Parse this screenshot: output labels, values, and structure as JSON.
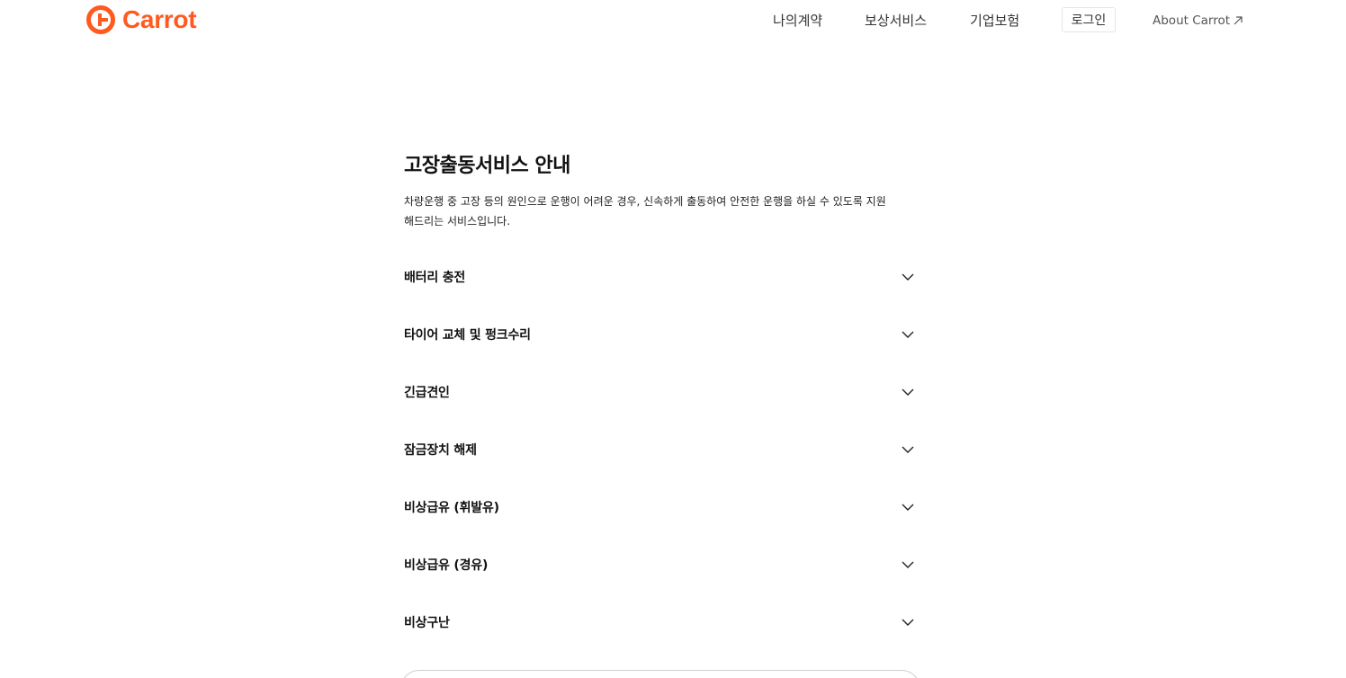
{
  "header": {
    "logo_text": "Carrot",
    "brand_color": "#ff5a1f",
    "nav": {
      "my_contract": "나의계약",
      "claim_service": "보상서비스",
      "corporate": "기업보험",
      "login": "로그인",
      "about": "About Carrot"
    },
    "about_icon": "arrow-up-right-icon"
  },
  "main": {
    "title": "고장출동서비스 안내",
    "description": "차량운행 중 고장 등의 원인으로 운행이 어려운 경우, 신속하게 출동하여 안전한 운행을 하실 수 있도록 지원해드리는 서비스입니다.",
    "accordion": [
      {
        "label": "배터리 충전",
        "icon": "chevron-down-icon"
      },
      {
        "label": "타이어 교체 및 펑크수리",
        "icon": "chevron-down-icon"
      },
      {
        "label": "긴급견인",
        "icon": "chevron-down-icon"
      },
      {
        "label": "잠금장치 해제",
        "icon": "chevron-down-icon"
      },
      {
        "label": "비상급유 (휘발유)",
        "icon": "chevron-down-icon"
      },
      {
        "label": "비상급유 (경유)",
        "icon": "chevron-down-icon"
      },
      {
        "label": "비상구난",
        "icon": "chevron-down-icon"
      }
    ]
  }
}
